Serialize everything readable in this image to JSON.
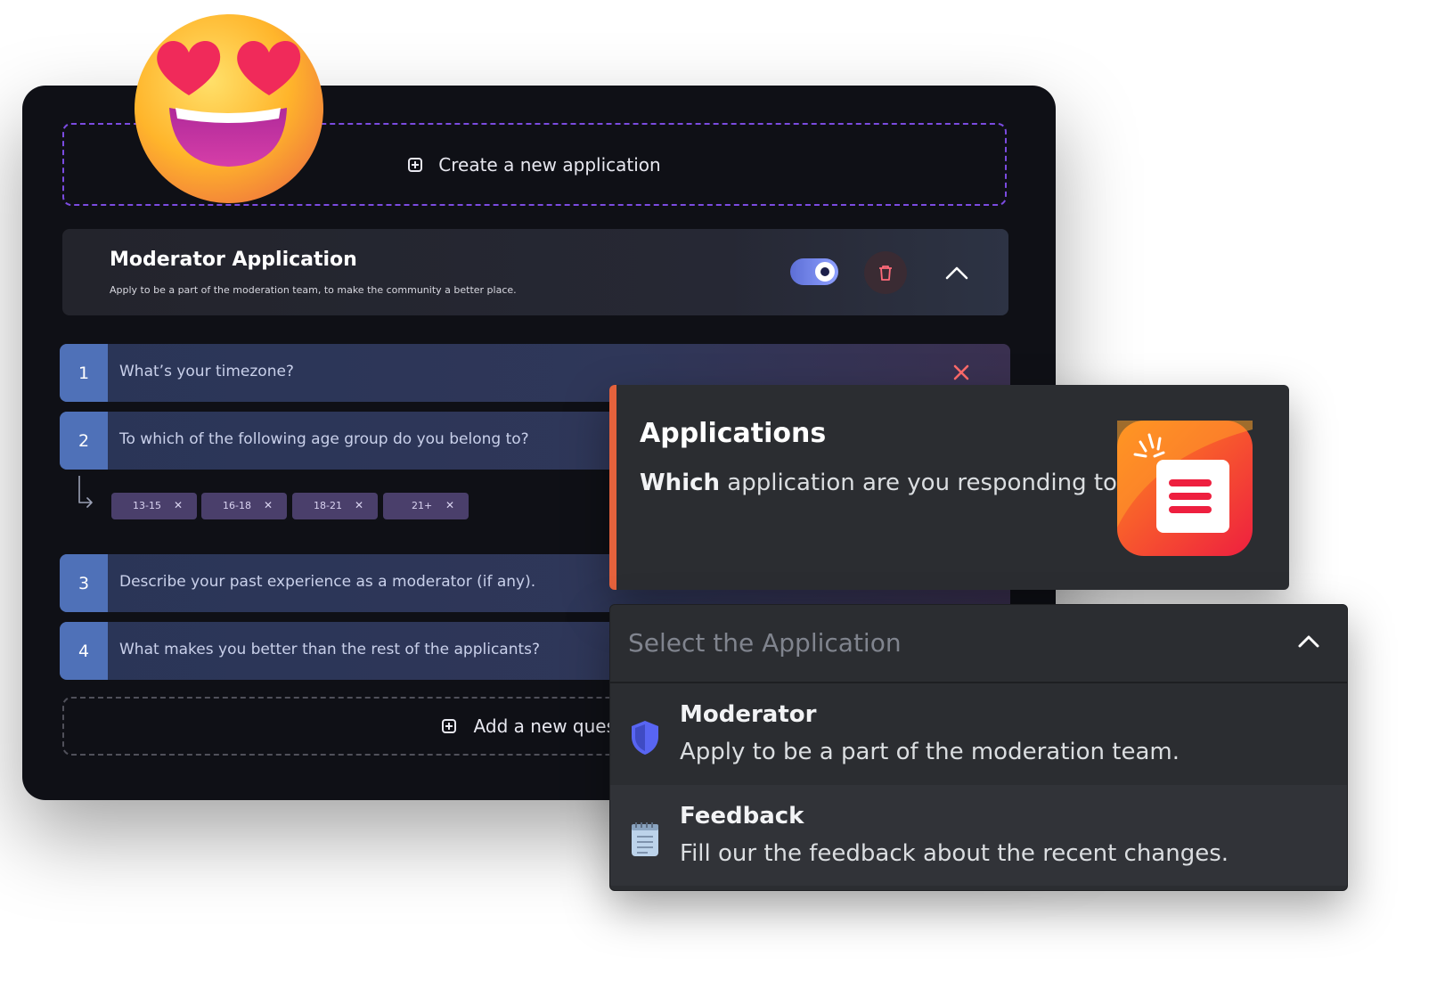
{
  "create_label": "Create a new application",
  "application": {
    "title": "Moderator Application",
    "description": "Apply to be a part of the moderation team, to make the community a better place.",
    "enabled": true
  },
  "questions": [
    {
      "number": "1",
      "text": "What’s your timezone?"
    },
    {
      "number": "2",
      "text": "To which of the following age group do you belong to?"
    },
    {
      "number": "3",
      "text": "Describe your past experience as a moderator (if any)."
    },
    {
      "number": "4",
      "text": "What makes you better than the rest of the applicants?"
    }
  ],
  "age_options": [
    "13-15",
    "16-18",
    "18-21",
    "21+"
  ],
  "add_question_label": "Add a new questi",
  "embed": {
    "title": "Applications",
    "question_bold": "Which",
    "question_rest": " application are you responding to?",
    "accent_color": "#e5623c"
  },
  "select": {
    "placeholder": "Select the Application",
    "options": [
      {
        "label": "Moderator",
        "description": "Apply to be a part of the moderation team.",
        "icon": "shield-icon"
      },
      {
        "label": "Feedback",
        "description": "Fill our the feedback about the recent changes.",
        "icon": "notepad-icon"
      }
    ]
  },
  "colors": {
    "accent": "#7b4be0",
    "question_number": "#4f71b8",
    "tag": "#4a3f6b"
  }
}
